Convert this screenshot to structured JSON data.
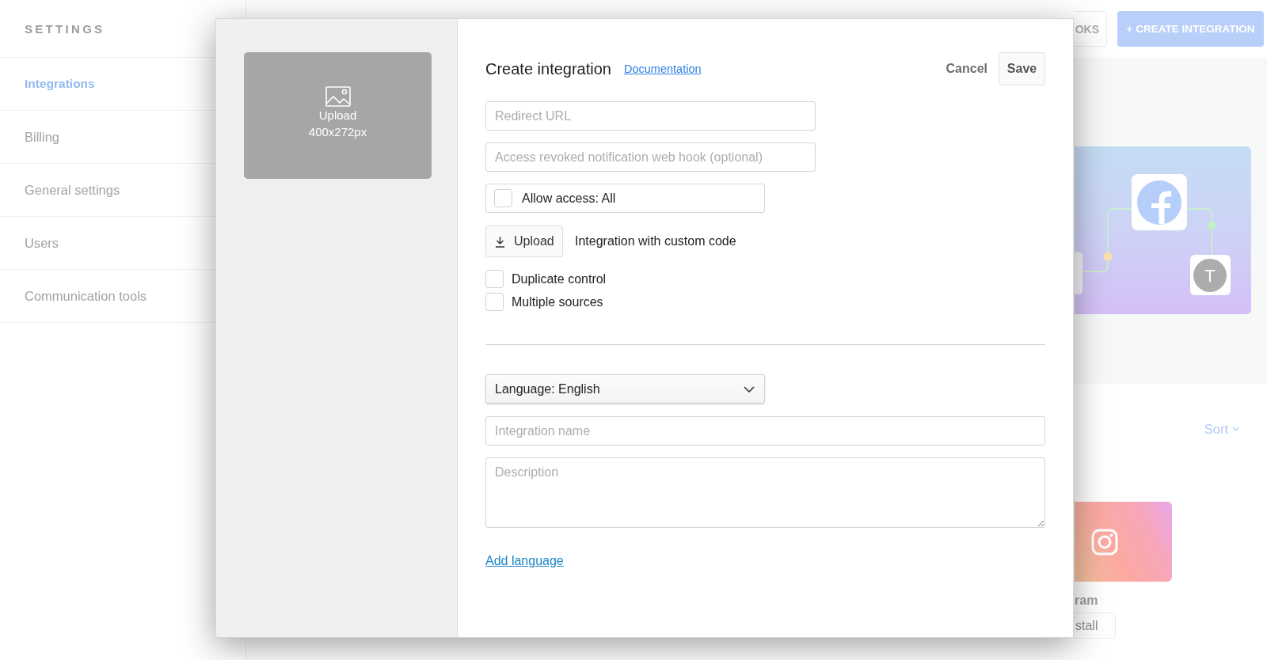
{
  "sidebar": {
    "title": "SETTINGS",
    "items": [
      {
        "label": "Integrations",
        "selected": true
      },
      {
        "label": "Billing",
        "selected": false
      },
      {
        "label": "General settings",
        "selected": false
      },
      {
        "label": "Users",
        "selected": false
      },
      {
        "label": "Communication tools",
        "selected": false
      }
    ]
  },
  "header": {
    "buttons": [
      {
        "label": "OKS",
        "kind": "outline"
      },
      {
        "label": "+ CREATE INTEGRATION",
        "kind": "primary"
      }
    ]
  },
  "banner": {
    "avatar_letter": "T"
  },
  "catalog": {
    "sort": "Sort",
    "card": {
      "name": "ram",
      "button": "stall"
    }
  },
  "dialog": {
    "image_upload": {
      "label": "Upload",
      "size": "400x272px"
    },
    "title": "Create integration",
    "documentation_link": "Documentation",
    "cancel": "Cancel",
    "save": "Save",
    "redirect_url": {
      "placeholder": "Redirect URL"
    },
    "webhook": {
      "placeholder": "Access revoked notification web hook (optional)"
    },
    "allow_access": {
      "label": "Allow access: All",
      "checked": false
    },
    "code_upload": {
      "button": "Upload",
      "label": "Integration with custom code"
    },
    "options": [
      {
        "label": "Duplicate control",
        "checked": false
      },
      {
        "label": "Multiple sources",
        "checked": false
      }
    ],
    "language": {
      "value": "Language: English"
    },
    "name": {
      "placeholder": "Integration name"
    },
    "description": {
      "placeholder": "Description"
    },
    "add_language": "Add language"
  }
}
